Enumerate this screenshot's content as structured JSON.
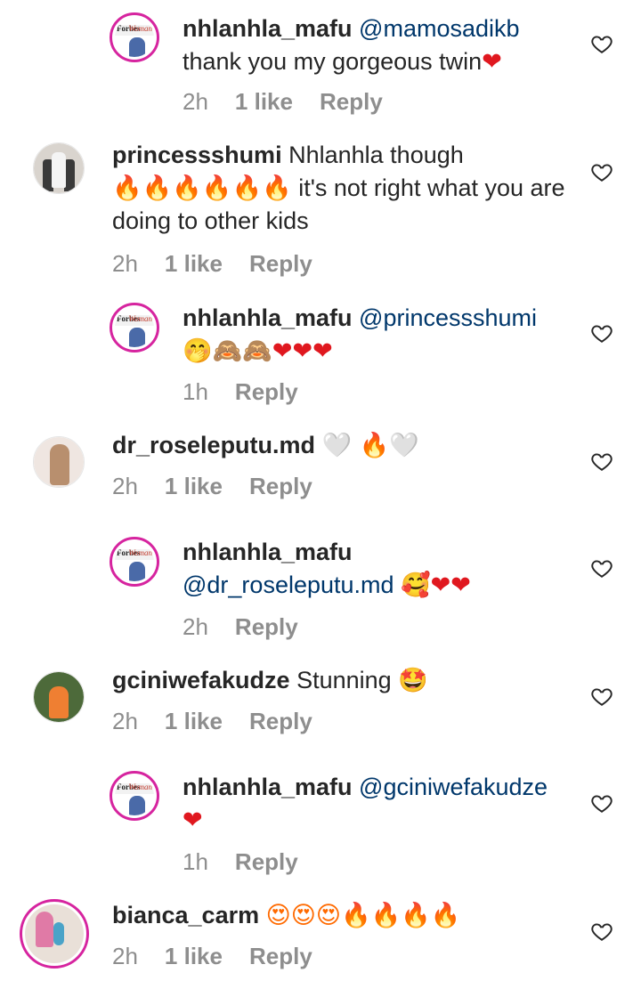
{
  "comments": [
    {
      "username": "nhlanhla_mafu",
      "mention": "@mamosadikb",
      "text": "thank you my gorgeous twin",
      "emoji": "❤",
      "time": "2h",
      "likes": "1 like",
      "reply": "Reply"
    },
    {
      "username": "princessshumi",
      "text_before": "Nhlanhla though",
      "emoji": "🔥🔥🔥🔥🔥🔥",
      "text_after": "it's not right what you are doing to other kids",
      "time": "2h",
      "likes": "1 like",
      "reply": "Reply"
    },
    {
      "username": "nhlanhla_mafu",
      "mention": "@princessshumi",
      "emoji": "🤭🙈🙈❤❤❤",
      "time": "1h",
      "reply": "Reply"
    },
    {
      "username": "dr_roseleputu.md",
      "emoji": "🤍 🔥🤍",
      "time": "2h",
      "likes": "1 like",
      "reply": "Reply"
    },
    {
      "username": "nhlanhla_mafu",
      "mention": "@dr_roseleputu.md",
      "emoji": "🥰❤❤",
      "time": "2h",
      "reply": "Reply"
    },
    {
      "username": "gciniwefakudze",
      "text": "Stunning",
      "emoji": "🤩",
      "time": "2h",
      "likes": "1 like",
      "reply": "Reply"
    },
    {
      "username": "nhlanhla_mafu",
      "mention": "@gciniwefakudze",
      "emoji": "❤",
      "time": "1h",
      "reply": "Reply"
    },
    {
      "username": "bianca_carm",
      "emoji": "😍😍😍🔥🔥🔥🔥",
      "time": "2h",
      "likes": "1 like",
      "reply": "Reply"
    }
  ],
  "avatars": {
    "mafu_caption_left": "Forbes",
    "mafu_caption_right": "Woman"
  },
  "icons": {
    "heart": "heart-outline-icon"
  },
  "colors": {
    "text": "#262626",
    "meta": "#8e8e8e",
    "mention": "#00376b",
    "story_ring": "#d6249f"
  }
}
